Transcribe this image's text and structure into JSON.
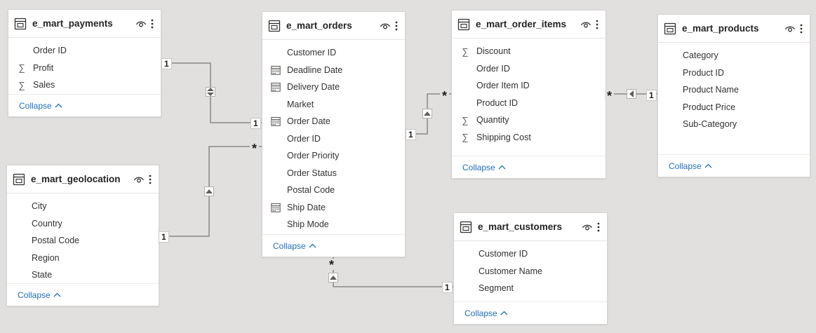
{
  "tables": {
    "payments": {
      "name": "e_mart_payments",
      "fields": [
        {
          "label": "Order ID",
          "icon": ""
        },
        {
          "label": "Profit",
          "icon": "sigma-icon"
        },
        {
          "label": "Sales",
          "icon": "sigma-icon"
        }
      ],
      "collapse": "Collapse"
    },
    "geolocation": {
      "name": "e_mart_geolocation",
      "fields": [
        {
          "label": "City",
          "icon": ""
        },
        {
          "label": "Country",
          "icon": ""
        },
        {
          "label": "Postal Code",
          "icon": ""
        },
        {
          "label": "Region",
          "icon": ""
        },
        {
          "label": "State",
          "icon": ""
        }
      ],
      "collapse": "Collapse"
    },
    "orders": {
      "name": "e_mart_orders",
      "fields": [
        {
          "label": "Customer ID",
          "icon": ""
        },
        {
          "label": "Deadline Date",
          "icon": "calendar-icon"
        },
        {
          "label": "Delivery Date",
          "icon": "calendar-icon"
        },
        {
          "label": "Market",
          "icon": ""
        },
        {
          "label": "Order Date",
          "icon": "calendar-icon"
        },
        {
          "label": "Order ID",
          "icon": ""
        },
        {
          "label": "Order Priority",
          "icon": ""
        },
        {
          "label": "Order Status",
          "icon": ""
        },
        {
          "label": "Postal Code",
          "icon": ""
        },
        {
          "label": "Ship Date",
          "icon": "calendar-icon"
        },
        {
          "label": "Ship Mode",
          "icon": ""
        }
      ],
      "collapse": "Collapse"
    },
    "order_items": {
      "name": "e_mart_order_items",
      "fields": [
        {
          "label": "Discount",
          "icon": "sigma-icon"
        },
        {
          "label": "Order ID",
          "icon": ""
        },
        {
          "label": "Order Item ID",
          "icon": ""
        },
        {
          "label": "Product ID",
          "icon": ""
        },
        {
          "label": "Quantity",
          "icon": "sigma-icon"
        },
        {
          "label": "Shipping Cost",
          "icon": "sigma-icon"
        }
      ],
      "collapse": "Collapse"
    },
    "customers": {
      "name": "e_mart_customers",
      "fields": [
        {
          "label": "Customer ID",
          "icon": ""
        },
        {
          "label": "Customer Name",
          "icon": ""
        },
        {
          "label": "Segment",
          "icon": ""
        }
      ],
      "collapse": "Collapse"
    },
    "products": {
      "name": "e_mart_products",
      "fields": [
        {
          "label": "Category",
          "icon": ""
        },
        {
          "label": "Product ID",
          "icon": ""
        },
        {
          "label": "Product Name",
          "icon": ""
        },
        {
          "label": "Product Price",
          "icon": ""
        },
        {
          "label": "Sub-Category",
          "icon": ""
        }
      ],
      "collapse": "Collapse"
    }
  },
  "relationships": {
    "payments_orders": {
      "from_card": "1",
      "to_card": "1",
      "direction": "both"
    },
    "geolocation_orders": {
      "from_card": "1",
      "to_card": "*",
      "direction": "up"
    },
    "orders_order_items": {
      "from_card": "1",
      "to_card": "*",
      "direction": "up"
    },
    "customers_orders": {
      "from_card": "1",
      "to_card": "*",
      "direction": "up"
    },
    "products_order_items": {
      "from_card": "1",
      "to_card": "*",
      "direction": "left"
    }
  },
  "colors": {
    "canvas": "#e1e0df",
    "card": "#ffffff",
    "line": "#8a8886",
    "link": "#1f6fbf"
  }
}
